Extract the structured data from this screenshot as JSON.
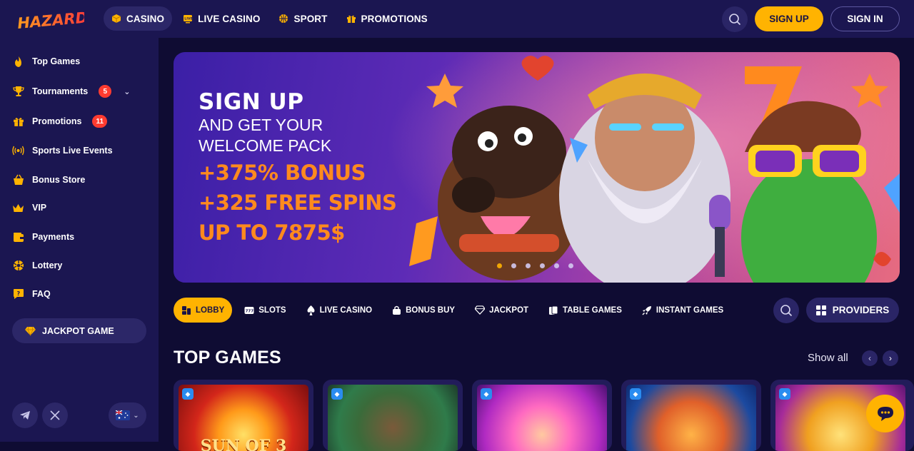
{
  "brand": {
    "name": "HAZARD",
    "accent": "#ffb301",
    "bg": "#0f0c33",
    "panel": "#1b1651"
  },
  "topnav": {
    "items": [
      {
        "label": "CASINO",
        "icon": "cube-icon",
        "active": true
      },
      {
        "label": "LIVE CASINO",
        "icon": "live-tv-icon",
        "active": false
      },
      {
        "label": "SPORT",
        "icon": "ball-icon",
        "active": false
      },
      {
        "label": "PROMOTIONS",
        "icon": "gift-icon",
        "active": false
      }
    ],
    "signup": "SIGN UP",
    "signin": "SIGN IN"
  },
  "sidebar": {
    "items": [
      {
        "label": "Top Games",
        "icon": "fire-icon"
      },
      {
        "label": "Tournaments",
        "icon": "trophy-icon",
        "badge": "5"
      },
      {
        "label": "Promotions",
        "icon": "gift-icon",
        "badge": "11"
      },
      {
        "label": "Sports Live Events",
        "icon": "broadcast-icon"
      },
      {
        "label": "Bonus Store",
        "icon": "basket-icon"
      },
      {
        "label": "VIP",
        "icon": "crown-icon"
      },
      {
        "label": "Payments",
        "icon": "wallet-icon"
      },
      {
        "label": "Lottery",
        "icon": "lottery-ball-icon"
      },
      {
        "label": "FAQ",
        "icon": "help-chat-icon"
      }
    ],
    "jackpot_game": "JACKPOT GAME",
    "language": "AU"
  },
  "banner": {
    "line1": "SIGN UP",
    "line2": "AND GET YOUR",
    "line3": "WELCOME PACK",
    "line4": "+375% BONUS",
    "line5": "+325 FREE SPINS",
    "line6": "UP TO 7875$",
    "slides": 6,
    "active_slide": 0
  },
  "tabs": {
    "items": [
      {
        "label": "LOBBY",
        "icon": "lobby-icon",
        "active": true
      },
      {
        "label": "SLOTS",
        "icon": "slots-icon",
        "active": false
      },
      {
        "label": "LIVE CASINO",
        "icon": "spade-icon",
        "active": false
      },
      {
        "label": "BONUS BUY",
        "icon": "bonus-bag-icon",
        "active": false
      },
      {
        "label": "JACKPOT",
        "icon": "diamond-icon",
        "active": false
      },
      {
        "label": "TABLE GAMES",
        "icon": "cards-icon",
        "active": false
      },
      {
        "label": "INSTANT GAMES",
        "icon": "rocket-icon",
        "active": false
      }
    ],
    "providers": "PROVIDERS"
  },
  "top_games": {
    "title": "TOP GAMES",
    "show_all": "Show all",
    "cards": [
      {
        "name": "sun-of-egypt-card",
        "title": "SUN OF 3"
      },
      {
        "name": "snoop-game-card",
        "title": ""
      },
      {
        "name": "joker-game-card",
        "title": ""
      },
      {
        "name": "tiger-game-card",
        "title": ""
      },
      {
        "name": "dragon-game-card",
        "title": ""
      }
    ]
  }
}
